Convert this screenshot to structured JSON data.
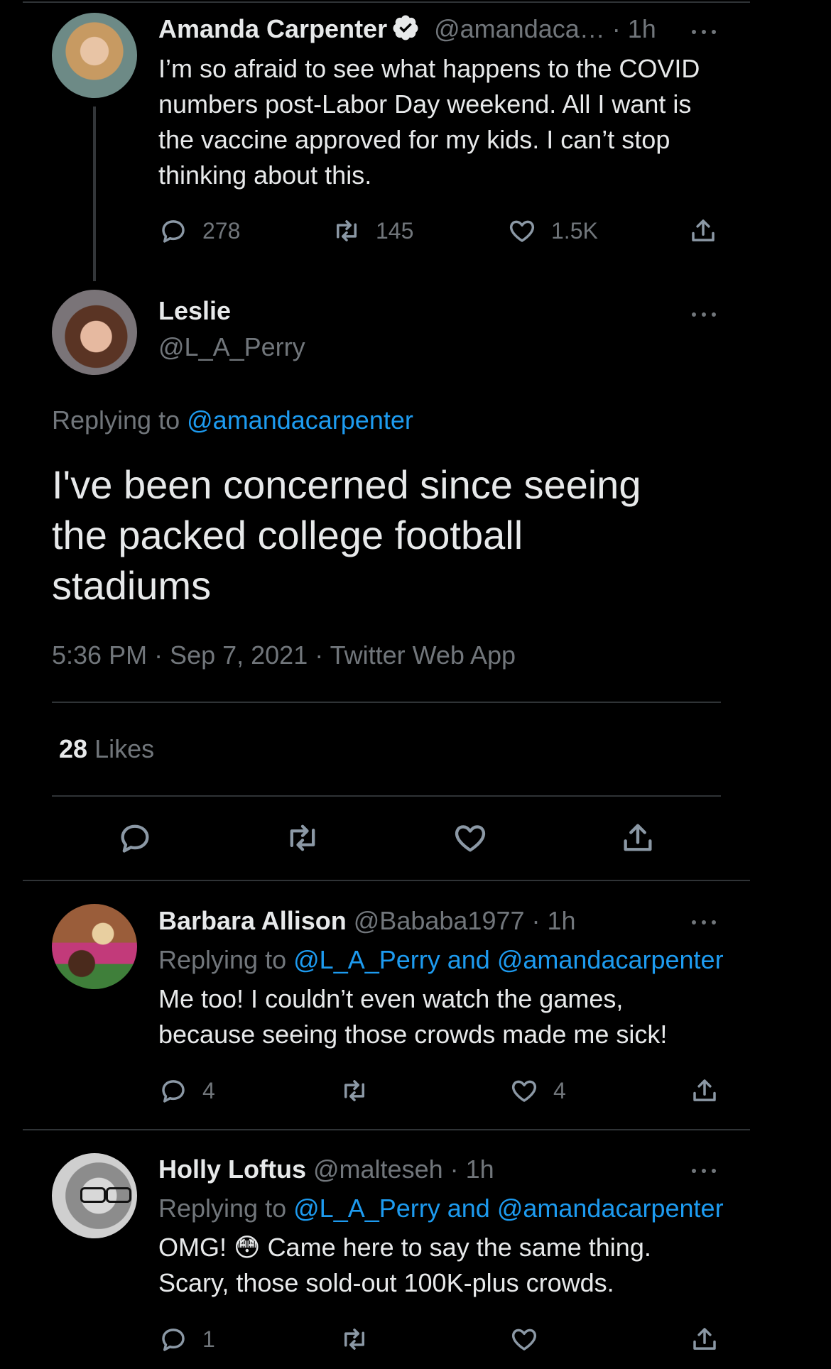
{
  "tweet1": {
    "name": "Amanda Carpenter",
    "handle": "@amandaca…",
    "time": "· 1h",
    "text": "I’m so afraid to see what happens to the COVID numbers post-Labor Day weekend. All I want is the vaccine approved for my kids. I can’t stop thinking about this.",
    "replies": "278",
    "retweets": "145",
    "likes": "1.5K"
  },
  "main": {
    "name": "Leslie",
    "handle": "@L_A_Perry",
    "replying_label": "Replying to",
    "replying_to": "@amandacarpenter",
    "text": "I've been concerned since seeing the packed college football stadiums",
    "timestamp": "5:36 PM · Sep 7, 2021 · Twitter Web App",
    "likes_count": "28",
    "likes_label": "Likes"
  },
  "reply1": {
    "name": "Barbara Allison",
    "handle": "@Bababa1977",
    "time": "· 1h",
    "replying_label": "Replying to",
    "replying_to": "@L_A_Perry and @amandacarpenter",
    "text": "Me too! I couldn’t even watch the games, because seeing those crowds made me sick!",
    "replies": "4",
    "retweets": "",
    "likes": "4"
  },
  "reply2": {
    "name": "Holly Loftus",
    "handle": "@malteseh",
    "time": "· 1h",
    "replying_label": "Replying to",
    "replying_to": "@L_A_Perry and @amandacarpenter",
    "text_before": "OMG!",
    "emoji": "😳",
    "text_after": "Came here to say the same thing. Scary, those sold-out 100K-plus crowds.",
    "replies": "1",
    "retweets": "",
    "likes": ""
  },
  "colors": {
    "background": "#000000",
    "text": "#e7e9ea",
    "muted": "#71767b",
    "link": "#1d9bf0",
    "divider": "#2f3336"
  },
  "icons": [
    "verified-badge-icon",
    "more-icon",
    "reply-icon",
    "retweet-icon",
    "like-icon",
    "share-icon"
  ]
}
